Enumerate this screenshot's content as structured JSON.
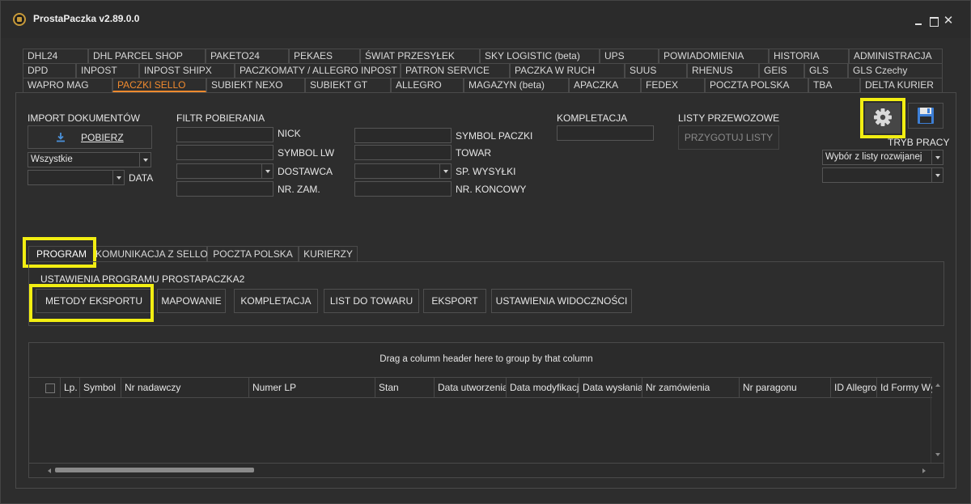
{
  "window": {
    "title": "ProstaPaczka v2.89.0.0",
    "icons": {
      "app": "app-logo-icon",
      "minimize": "minimize-icon",
      "maximize": "maximize-icon",
      "close": "close-icon"
    },
    "close_glyph": "✕"
  },
  "tabs": {
    "row1": [
      "DHL24",
      "DHL PARCEL SHOP",
      "PAKETO24",
      "PEKAES",
      "ŚWIAT PRZESYŁEK",
      "SKY LOGISTIC (beta)",
      "UPS",
      "POWIADOMIENIA",
      "HISTORIA",
      "ADMINISTRACJA"
    ],
    "row2": [
      "DPD",
      "INPOST",
      "INPOST SHIPX",
      "PACZKOMATY / ALLEGRO INPOST",
      "PATRON SERVICE",
      "PACZKA W RUCH",
      "SUUS",
      "RHENUS",
      "GEIS",
      "GLS",
      "GLS Czechy"
    ],
    "row3": [
      "WAPRO MAG",
      "PACZKI SELLO",
      "SUBIEKT NEXO",
      "SUBIEKT GT",
      "ALLEGRO",
      "MAGAZYN (beta)",
      "APACZKA",
      "FEDEX",
      "POCZTA POLSKA",
      "TBA",
      "DELTA KURIER"
    ],
    "active": "PACZKI SELLO",
    "accent_color": "#f08a2e"
  },
  "import": {
    "title": "IMPORT DOKUMENTÓW",
    "pobierz_label": "POBIERZ",
    "pobierz_icon": "download-icon",
    "source_value": "Wszystkie",
    "date_value": "",
    "date_label": "DATA"
  },
  "filter": {
    "title": "FILTR POBIERANIA",
    "labels_left": [
      "NICK",
      "SYMBOL LW",
      "DOSTAWCA",
      "NR. ZAM."
    ],
    "labels_right": [
      "SYMBOL PACZKI",
      "TOWAR",
      "SP. WYSYŁKI",
      "NR. KONCOWY"
    ]
  },
  "kompletacja": {
    "title": "KOMPLETACJA",
    "value": ""
  },
  "listy": {
    "title": "LISTY PRZEWOZOWE",
    "button": "PRZYGOTUJ LISTY"
  },
  "toolbar": {
    "gear_icon": "gear-icon",
    "save_icon": "floppy-disk-icon"
  },
  "tryb": {
    "title": "TRYB PRACY",
    "select_value": "Wybór z listy rozwijanej",
    "second_value": ""
  },
  "inner_tabs": [
    "PROGRAM",
    "KOMUNIKACJA Z SELLO",
    "POCZTA POLSKA",
    "KURIERZY"
  ],
  "program": {
    "section_title": "USTAWIENIA PROGRAMU PROSTAPACZKA2",
    "buttons": [
      "METODY EKSPORTU",
      "MAPOWANIE",
      "KOMPLETACJA",
      "LIST DO TOWARU",
      "EKSPORT",
      "USTAWIENIA WIDOCZNOŚCI"
    ]
  },
  "grid": {
    "group_hint": "Drag a column header here to group by that column",
    "columns": [
      "Lp.",
      "Symbol",
      "Nr nadawczy",
      "Numer LP",
      "Stan",
      "Data utworzenia",
      "Data modyfikacji",
      "Data wysłania",
      "Nr zamówienia",
      "Nr paragonu",
      "ID Allegro",
      "Id Formy Wys"
    ]
  },
  "highlight_color": "#f2ee12"
}
